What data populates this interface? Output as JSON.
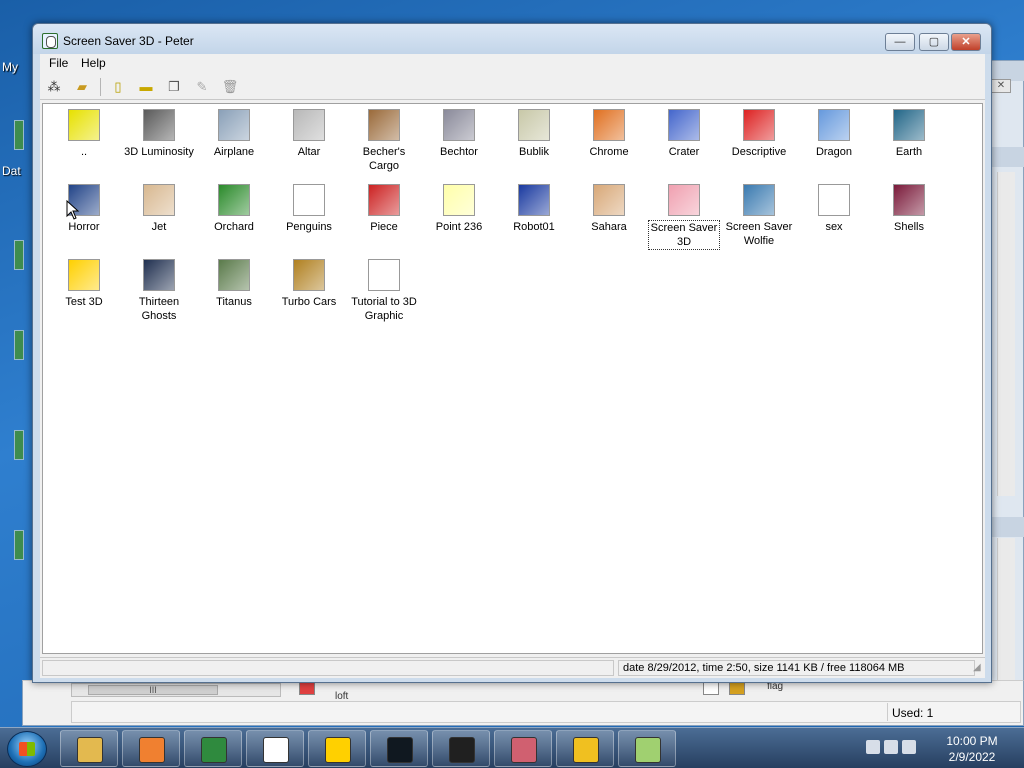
{
  "window": {
    "title": "Screen Saver 3D - Peter",
    "controls": {
      "minimize": "—",
      "maximize": "▢",
      "close": "✕"
    }
  },
  "menu": [
    "File",
    "Help"
  ],
  "toolbar_icons": [
    "tree-icon",
    "open-folder-icon",
    "new-file-icon",
    "new-folder-icon",
    "copy-icon",
    "rename-icon",
    "delete-icon"
  ],
  "items": [
    [
      "..",
      "3D Luminosity",
      "Airplane",
      "Altar",
      "Becher's Cargo",
      "Bechtor",
      "Bublik",
      "Chrome",
      "Crater",
      "Descriptive",
      "Dragon",
      "Earth"
    ],
    [
      "Horror",
      "Jet",
      "Orchard",
      "Penguins",
      "Piece",
      "Point 236",
      "Robot01",
      "Sahara",
      "Screen Saver 3D",
      "Screen Saver Wolfie",
      "sex",
      "Shells"
    ],
    [
      "Test 3D",
      "Thirteen Ghosts",
      "Titanus",
      "Turbo Cars",
      "Tutorial to 3D Graphic"
    ]
  ],
  "item_colors": [
    [
      "#e7e100",
      "#5a5a5a",
      "#8aa0b8",
      "#b8b8b8",
      "#9a6a3a",
      "#8a8a9a",
      "#c8c8a8",
      "#e07020",
      "#4466cc",
      "#dd2222",
      "#6699dd",
      "#226688"
    ],
    [
      "#224488",
      "#d8b890",
      "#2a8a2a",
      "#ffffff",
      "#cc2222",
      "#ffffaa",
      "#1a3aa0",
      "#d8a878",
      "#f0a0b0",
      "#3a7ab0",
      "#ffffff",
      "#7a1a3a"
    ],
    [
      "#ffd000",
      "#203050",
      "#5a7a4a",
      "#b08020",
      "#ffffff"
    ]
  ],
  "selected_item": "Screen Saver 3D",
  "status": {
    "right": "date 8/29/2012, time 2:50, size 1141 KB / free 118064 MB"
  },
  "desktop": {
    "labels": [
      "My",
      "Dat"
    ]
  },
  "bg_window": {
    "used": "Used: 1",
    "tag": "flag",
    "tag2": "loft",
    "scroll_thumb": "III"
  },
  "taskbar": {
    "apps": [
      "explorer-icon",
      "media-player-icon",
      "chrome-icon",
      "screen-saver-3d-icon",
      "test-3d-icon",
      "oscilloscope-icon",
      "cmd-icon",
      "puzzle-icon",
      "soccer-icon",
      "folder-view-icon"
    ],
    "app_colors": [
      "#e3b94f",
      "#f08030",
      "#2f8a3e",
      "#ffffff",
      "#ffd000",
      "#101820",
      "#202020",
      "#d06070",
      "#f0c020",
      "#a0d070"
    ],
    "time": "10:00 PM",
    "date": "2/9/2022"
  }
}
